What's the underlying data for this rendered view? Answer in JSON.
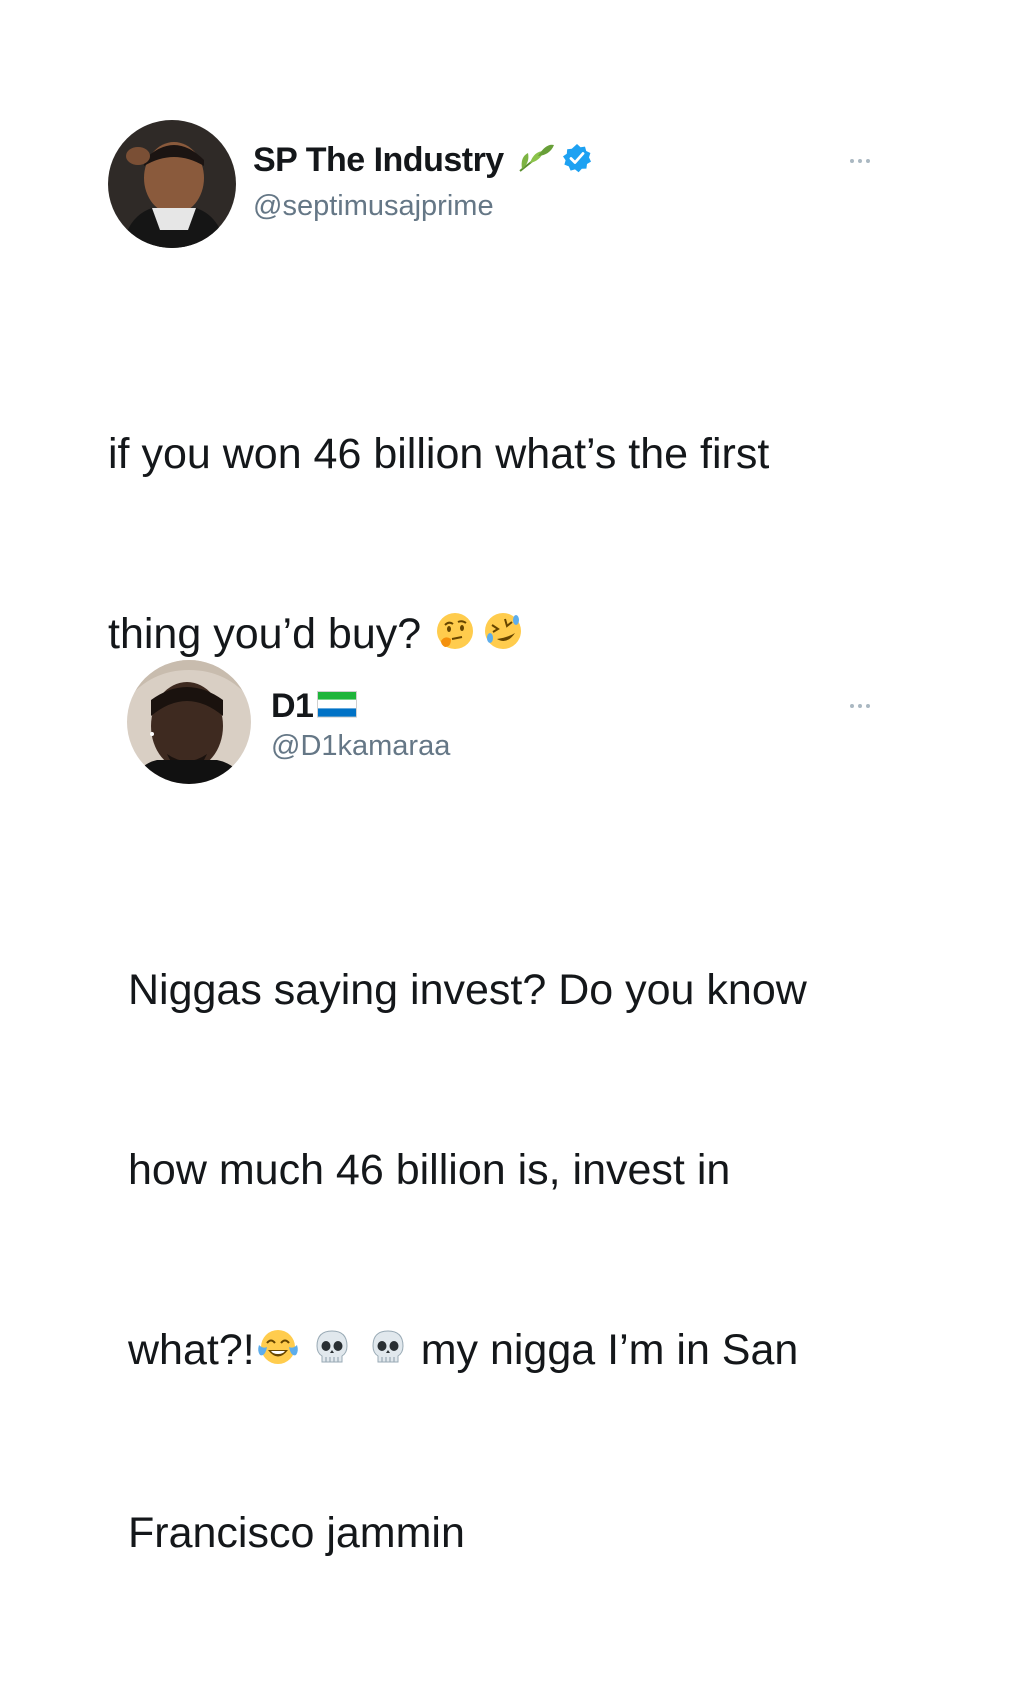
{
  "tweets": [
    {
      "display_name": "SP The Industry",
      "handle": "@septimusajprime",
      "verified": true,
      "name_emoji": "herb-icon",
      "text_lines": [
        "if you won 46 billion what’s the first",
        "thing you’d buy?"
      ],
      "text_emojis": [
        "thinking-face-icon",
        "rolling-on-floor-laughing-icon"
      ]
    },
    {
      "display_name": "D1",
      "handle": "@D1kamaraa",
      "verified": false,
      "name_emoji": "sierra-leone-flag-icon",
      "text_lines": [
        "Niggas saying invest? Do you know",
        "how much 46 billion is, invest in",
        "what?!",
        "my nigga I’m in San",
        "Francisco jammin"
      ],
      "text_emojis": [
        "face-with-tears-of-joy-icon",
        "skull-icon",
        "skull-icon"
      ]
    }
  ],
  "colors": {
    "text": "#14171a",
    "handle": "#657786",
    "verified": "#1da1f2",
    "more_dots": "#aab8c2"
  }
}
